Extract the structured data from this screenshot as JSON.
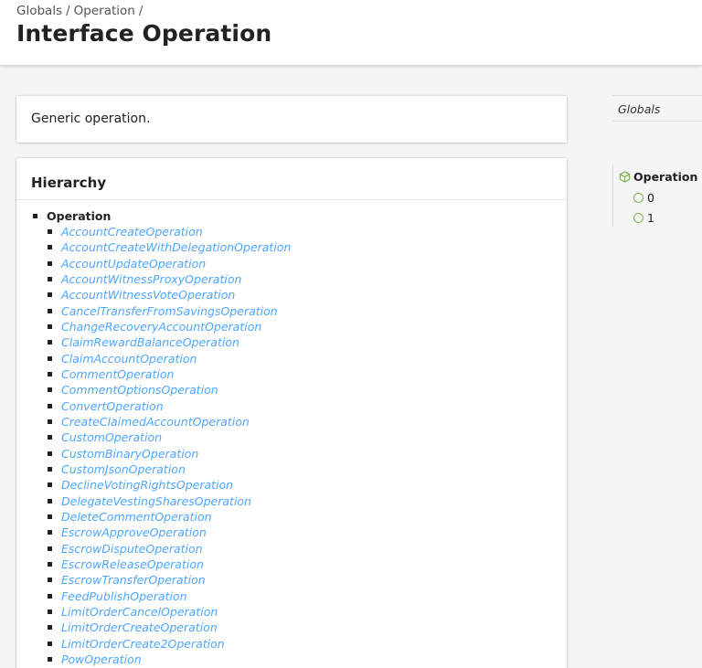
{
  "breadcrumb": {
    "globals": "Globals",
    "operation": "Operation",
    "sep1": "/",
    "sep2": "/"
  },
  "title": "Interface Operation",
  "description": "Generic operation.",
  "hierarchy": {
    "heading": "Hierarchy",
    "root": "Operation",
    "children": [
      "AccountCreateOperation",
      "AccountCreateWithDelegationOperation",
      "AccountUpdateOperation",
      "AccountWitnessProxyOperation",
      "AccountWitnessVoteOperation",
      "CancelTransferFromSavingsOperation",
      "ChangeRecoveryAccountOperation",
      "ClaimRewardBalanceOperation",
      "ClaimAccountOperation",
      "CommentOperation",
      "CommentOptionsOperation",
      "ConvertOperation",
      "CreateClaimedAccountOperation",
      "CustomOperation",
      "CustomBinaryOperation",
      "CustomJsonOperation",
      "DeclineVotingRightsOperation",
      "DelegateVestingSharesOperation",
      "DeleteCommentOperation",
      "EscrowApproveOperation",
      "EscrowDisputeOperation",
      "EscrowReleaseOperation",
      "EscrowTransferOperation",
      "FeedPublishOperation",
      "LimitOrderCancelOperation",
      "LimitOrderCreateOperation",
      "LimitOrderCreate2Operation",
      "PowOperation"
    ]
  },
  "sidebar": {
    "globals": "Globals",
    "current": "Operation",
    "current_icon": "interface-cube-icon",
    "properties": [
      "0",
      "1"
    ],
    "property_icon": "property-circle-icon"
  },
  "colors": {
    "link": "#4da6ff",
    "property_icon": "#7ab648",
    "interface_icon": "#7ab648"
  }
}
